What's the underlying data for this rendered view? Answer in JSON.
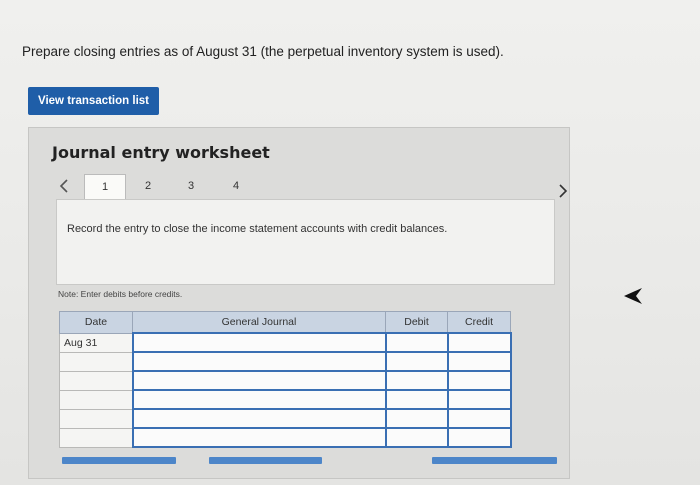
{
  "instruction": "Prepare closing entries as of August 31 (the perpetual inventory system is used).",
  "view_button_label": "View transaction list",
  "worksheet": {
    "title": "Journal entry worksheet",
    "prev_icon": "chevron-left-icon",
    "next_icon": "chevron-right-icon",
    "tabs": [
      "1",
      "2",
      "3",
      "4"
    ],
    "active_tab": "1",
    "entry_text": "Record the entry to close the income statement accounts with credit balances.",
    "note": "Note: Enter debits before credits."
  },
  "journal": {
    "headers": {
      "date": "Date",
      "general_journal": "General Journal",
      "debit": "Debit",
      "credit": "Credit"
    },
    "rows": [
      {
        "date": "Aug 31",
        "account": "",
        "debit": "",
        "credit": ""
      },
      {
        "date": "",
        "account": "",
        "debit": "",
        "credit": ""
      },
      {
        "date": "",
        "account": "",
        "debit": "",
        "credit": ""
      },
      {
        "date": "",
        "account": "",
        "debit": "",
        "credit": ""
      },
      {
        "date": "",
        "account": "",
        "debit": "",
        "credit": ""
      },
      {
        "date": "",
        "account": "",
        "debit": "",
        "credit": ""
      }
    ]
  },
  "colors": {
    "accent": "#1f5ea8",
    "header_fill": "#c9d4e2",
    "input_border": "#3a6fb3"
  }
}
